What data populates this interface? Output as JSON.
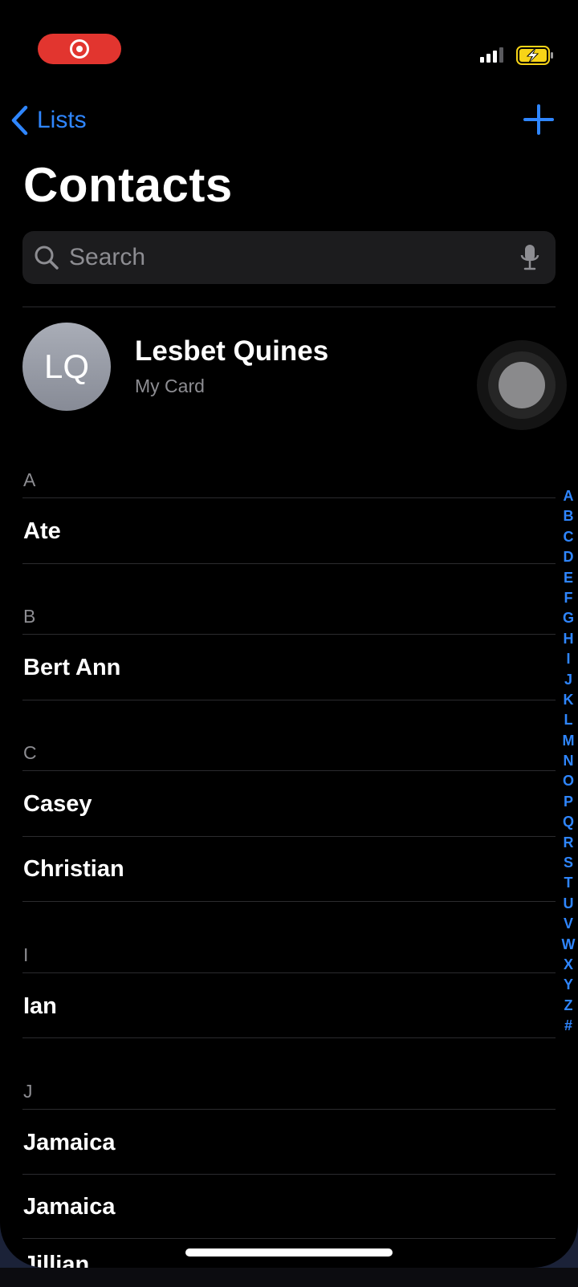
{
  "colors": {
    "accent": "#2f86ff",
    "record": "#e2352f",
    "background": "#000000",
    "battery_charging": "#f7d417"
  },
  "status_bar": {
    "recording_icon": "screen-record-icon",
    "signal_icon": "cellular-signal-icon",
    "battery_icon": "battery-charging-icon"
  },
  "nav": {
    "back_label": "Lists",
    "back_icon": "chevron-left-icon",
    "add_icon": "plus-icon"
  },
  "title": "Contacts",
  "search": {
    "placeholder": "Search",
    "icon": "magnifying-glass-icon",
    "mic_icon": "microphone-icon"
  },
  "my_card": {
    "initials": "LQ",
    "name": "Lesbet Quines",
    "subtitle": "My Card"
  },
  "sections": [
    {
      "letter": "A",
      "contacts": [
        "Ate"
      ]
    },
    {
      "letter": "B",
      "contacts": [
        "Bert Ann"
      ]
    },
    {
      "letter": "C",
      "contacts": [
        "Casey",
        "Christian"
      ]
    },
    {
      "letter": "I",
      "contacts": [
        "Ian"
      ]
    },
    {
      "letter": "J",
      "contacts": [
        "Jamaica",
        "Jamaica"
      ]
    }
  ],
  "partial_contact": "Jillian",
  "index_letters": [
    "A",
    "B",
    "C",
    "D",
    "E",
    "F",
    "G",
    "H",
    "I",
    "J",
    "K",
    "L",
    "M",
    "N",
    "O",
    "P",
    "Q",
    "R",
    "S",
    "T",
    "U",
    "V",
    "W",
    "X",
    "Y",
    "Z",
    "#"
  ]
}
